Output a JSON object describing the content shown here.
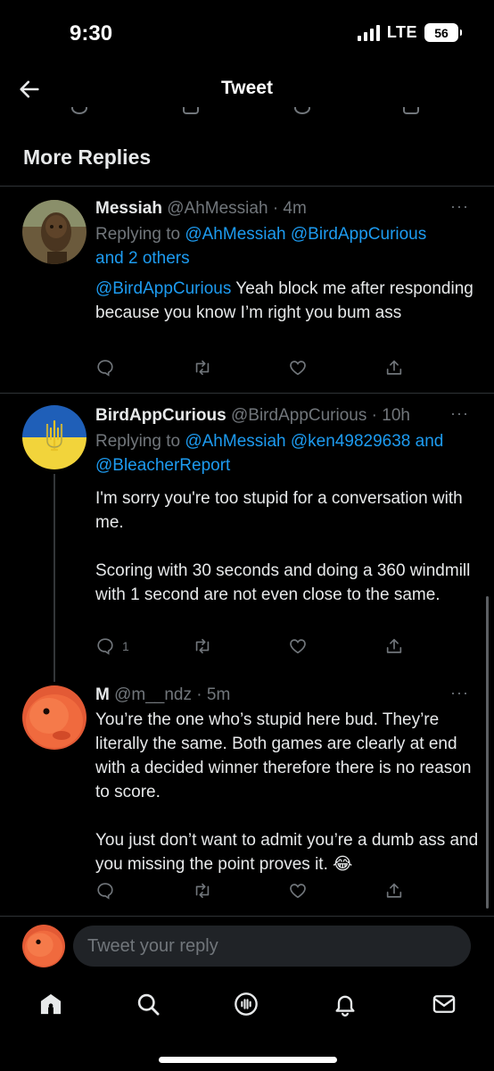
{
  "status_bar": {
    "time": "9:30",
    "network": "LTE",
    "battery": "56"
  },
  "header": {
    "title": "Tweet"
  },
  "section": {
    "title": "More Replies"
  },
  "tweets": [
    {
      "name": "Messiah",
      "handle": "@AhMessiah",
      "time": "· 4m",
      "more": "···",
      "replying_prefix": "Replying to",
      "replying_mentions": "@AhMessiah @BirdAppCurious",
      "replying_line2": "and 2 others",
      "body_mention": "@BirdAppCurious",
      "body": " Yeah block me after responding because you know I’m right you bum ass",
      "reply_count": ""
    },
    {
      "name": "BirdAppCurious",
      "handle": "@BirdAppCurious",
      "time": "· 10h",
      "more": "···",
      "replying_prefix": "Replying to",
      "replying_mentions": "@AhMessiah @ken49829638",
      "replying_and": "and",
      "replying_line2": "@BleacherReport",
      "body": "I'm sorry you're too stupid for a conversation with me.\n\nScoring with 30 seconds and doing a 360 windmill with 1 second are not even close to the same.",
      "reply_count": "1"
    },
    {
      "name": "M",
      "handle": "@m__ndz",
      "time": "· 5m",
      "more": "···",
      "body": "You’re the one who’s stupid here bud. They’re literally the same. Both games are clearly at end with a decided winner therefore there is no reason to score.\n\nYou just don’t want to admit you’re a dumb ass and you missing the point proves it. 😂",
      "reply_count": ""
    }
  ],
  "reply_box": {
    "placeholder": "Tweet your reply"
  },
  "icons": {
    "back": "arrow-left-icon",
    "reply": "comment-icon",
    "retweet": "retweet-icon",
    "like": "heart-icon",
    "share": "share-icon",
    "nav": [
      "home-icon",
      "search-icon",
      "spaces-icon",
      "notifications-icon",
      "messages-icon"
    ]
  },
  "colors": {
    "background": "#000000",
    "accent": "#1d9bf0",
    "muted": "#71767b",
    "text": "#e7e9ea",
    "divider": "#2f3336"
  }
}
